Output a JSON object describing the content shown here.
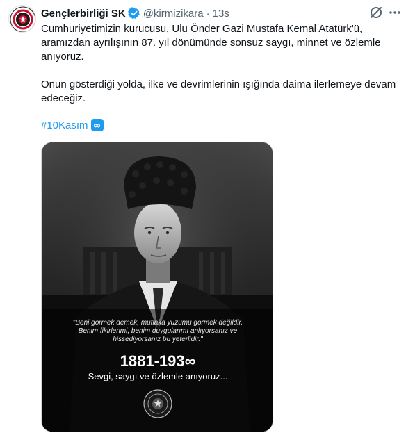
{
  "tweet": {
    "display_name": "Gençlerbirliği SK",
    "handle": "@kirmizikara",
    "separator": "·",
    "timestamp": "13s",
    "text_paragraph_1": "Cumhuriyetimizin kurucusu, Ulu Önder Gazi Mustafa Kemal Atatürk'ü, aramızdan ayrılışının 87. yıl dönümünde sonsuz saygı, minnet ve özlemle anıyoruz.",
    "text_paragraph_2": "Onun gösterdiği yolda, ilke ve devrimlerinin ışığında daima ilerlemeye devam edeceğiz.",
    "hashtag": "#10Kasım",
    "hashtag_emoji": "∞"
  },
  "media": {
    "quote": "\"Beni görmek demek, mutlaka yüzümü görmek değildir. Benim fikirlerimi, benim duygularımı anlıyorsanız ve hissediyorsanız bu yeterlidir.\"",
    "years": "1881-193∞",
    "subtitle": "Sevgi, saygı ve özlemle anıyoruz..."
  },
  "icons": {
    "verified": "verified-badge-icon",
    "grok": "grok-icon",
    "more": "more-options-icon",
    "avatar": "club-crest-icon",
    "crest_in_media": "club-crest-icon"
  },
  "colors": {
    "accent": "#1d9bf0",
    "text": "#0f1419",
    "secondary": "#536471",
    "club_red": "#c8102e"
  }
}
